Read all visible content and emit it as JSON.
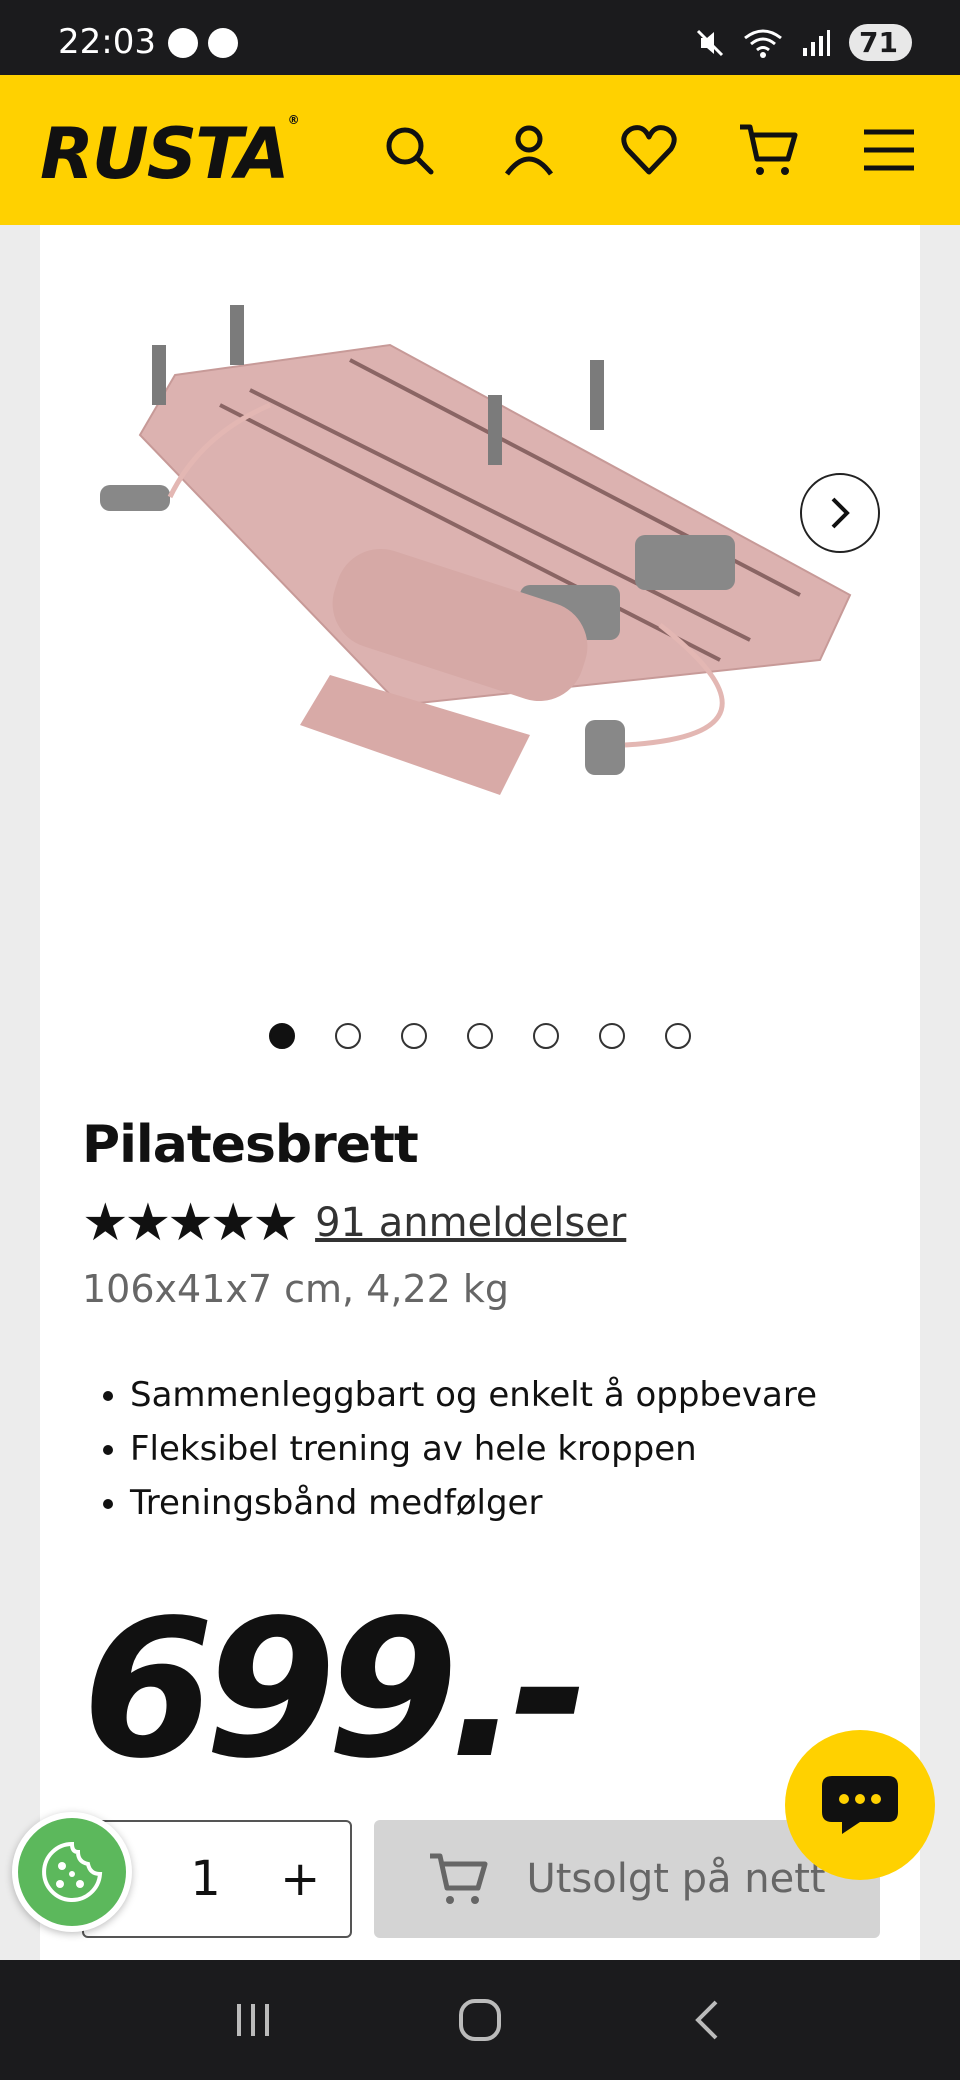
{
  "status_bar": {
    "time": "22:03",
    "battery": "71"
  },
  "header": {
    "logo": "RUSTA",
    "logo_mark": "®"
  },
  "product": {
    "title": "Pilatesbrett",
    "stars": "★★★★★",
    "rating": 4.9,
    "reviews": "91 anmeldelser",
    "dimensions": "106x41x7 cm, 4,22 kg",
    "bullets": [
      "Sammenleggbart og enkelt å oppbevare",
      "Fleksibel trening av hele kroppen",
      "Treningsbånd medfølger"
    ],
    "price": "699.-",
    "gallery_total": 7,
    "gallery_active": 1
  },
  "purchase": {
    "minus": "-",
    "quantity": "1",
    "plus": "+",
    "cart_label": "Utsolgt på nett"
  },
  "colors": {
    "brand_yellow": "#ffd100",
    "cookie_green": "#5cb85c",
    "disabled_gray": "#d4d4d4"
  },
  "icons": [
    "messenger-icon",
    "facebook-icon",
    "mute-icon",
    "wifi-icon",
    "signal-icon",
    "search-icon",
    "account-icon",
    "heart-icon",
    "cart-icon",
    "menu-icon",
    "chevron-right-icon",
    "chat-icon",
    "cookie-icon",
    "recents-icon",
    "home-icon",
    "back-icon"
  ]
}
